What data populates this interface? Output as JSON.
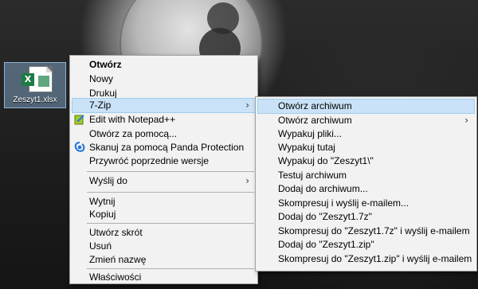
{
  "desktop": {
    "file_label": "Zeszyt1.xlsx",
    "file_icon": "excel-file-icon"
  },
  "context_menu": {
    "items": [
      {
        "label": "Otwórz",
        "bold": true
      },
      {
        "label": "Nowy"
      },
      {
        "label": "Drukuj"
      },
      {
        "label": "7-Zip",
        "submenu": true,
        "highlighted": true
      },
      {
        "label": "Edit with Notepad++",
        "icon": "notepadpp-icon"
      },
      {
        "label": "Otwórz za pomocą..."
      },
      {
        "label": "Skanuj za pomocą Panda Protection",
        "icon": "panda-protection-icon"
      },
      {
        "label": "Przywróć poprzednie wersje"
      },
      {
        "label": "Wyślij do",
        "submenu": true
      },
      {
        "label": "Wytnij"
      },
      {
        "label": "Kopiuj"
      },
      {
        "label": "Utwórz skrót"
      },
      {
        "label": "Usuń"
      },
      {
        "label": "Zmień nazwę"
      },
      {
        "label": "Właściwości"
      }
    ]
  },
  "submenu_7zip": {
    "items": [
      {
        "label": "Otwórz archiwum",
        "highlighted": true
      },
      {
        "label": "Otwórz archiwum",
        "submenu": true
      },
      {
        "label": "Wypakuj pliki..."
      },
      {
        "label": "Wypakuj tutaj"
      },
      {
        "label": "Wypakuj do \"Zeszyt1\\\""
      },
      {
        "label": "Testuj archiwum"
      },
      {
        "label": "Dodaj do archiwum..."
      },
      {
        "label": "Skompresuj i wyślij e-mailem..."
      },
      {
        "label": "Dodaj do \"Zeszyt1.7z\""
      },
      {
        "label": "Skompresuj do \"Zeszyt1.7z\" i wyślij e-mailem"
      },
      {
        "label": "Dodaj do \"Zeszyt1.zip\""
      },
      {
        "label": "Skompresuj do \"Zeszyt1.zip\" i wyślij e-mailem"
      }
    ]
  },
  "glyphs": {
    "chevron": "›",
    "excel_letter": "X"
  },
  "colors": {
    "highlight": "#c9e2f7",
    "menu_bg": "#f2f2f2",
    "selection_bg": "#8cb9e1"
  }
}
